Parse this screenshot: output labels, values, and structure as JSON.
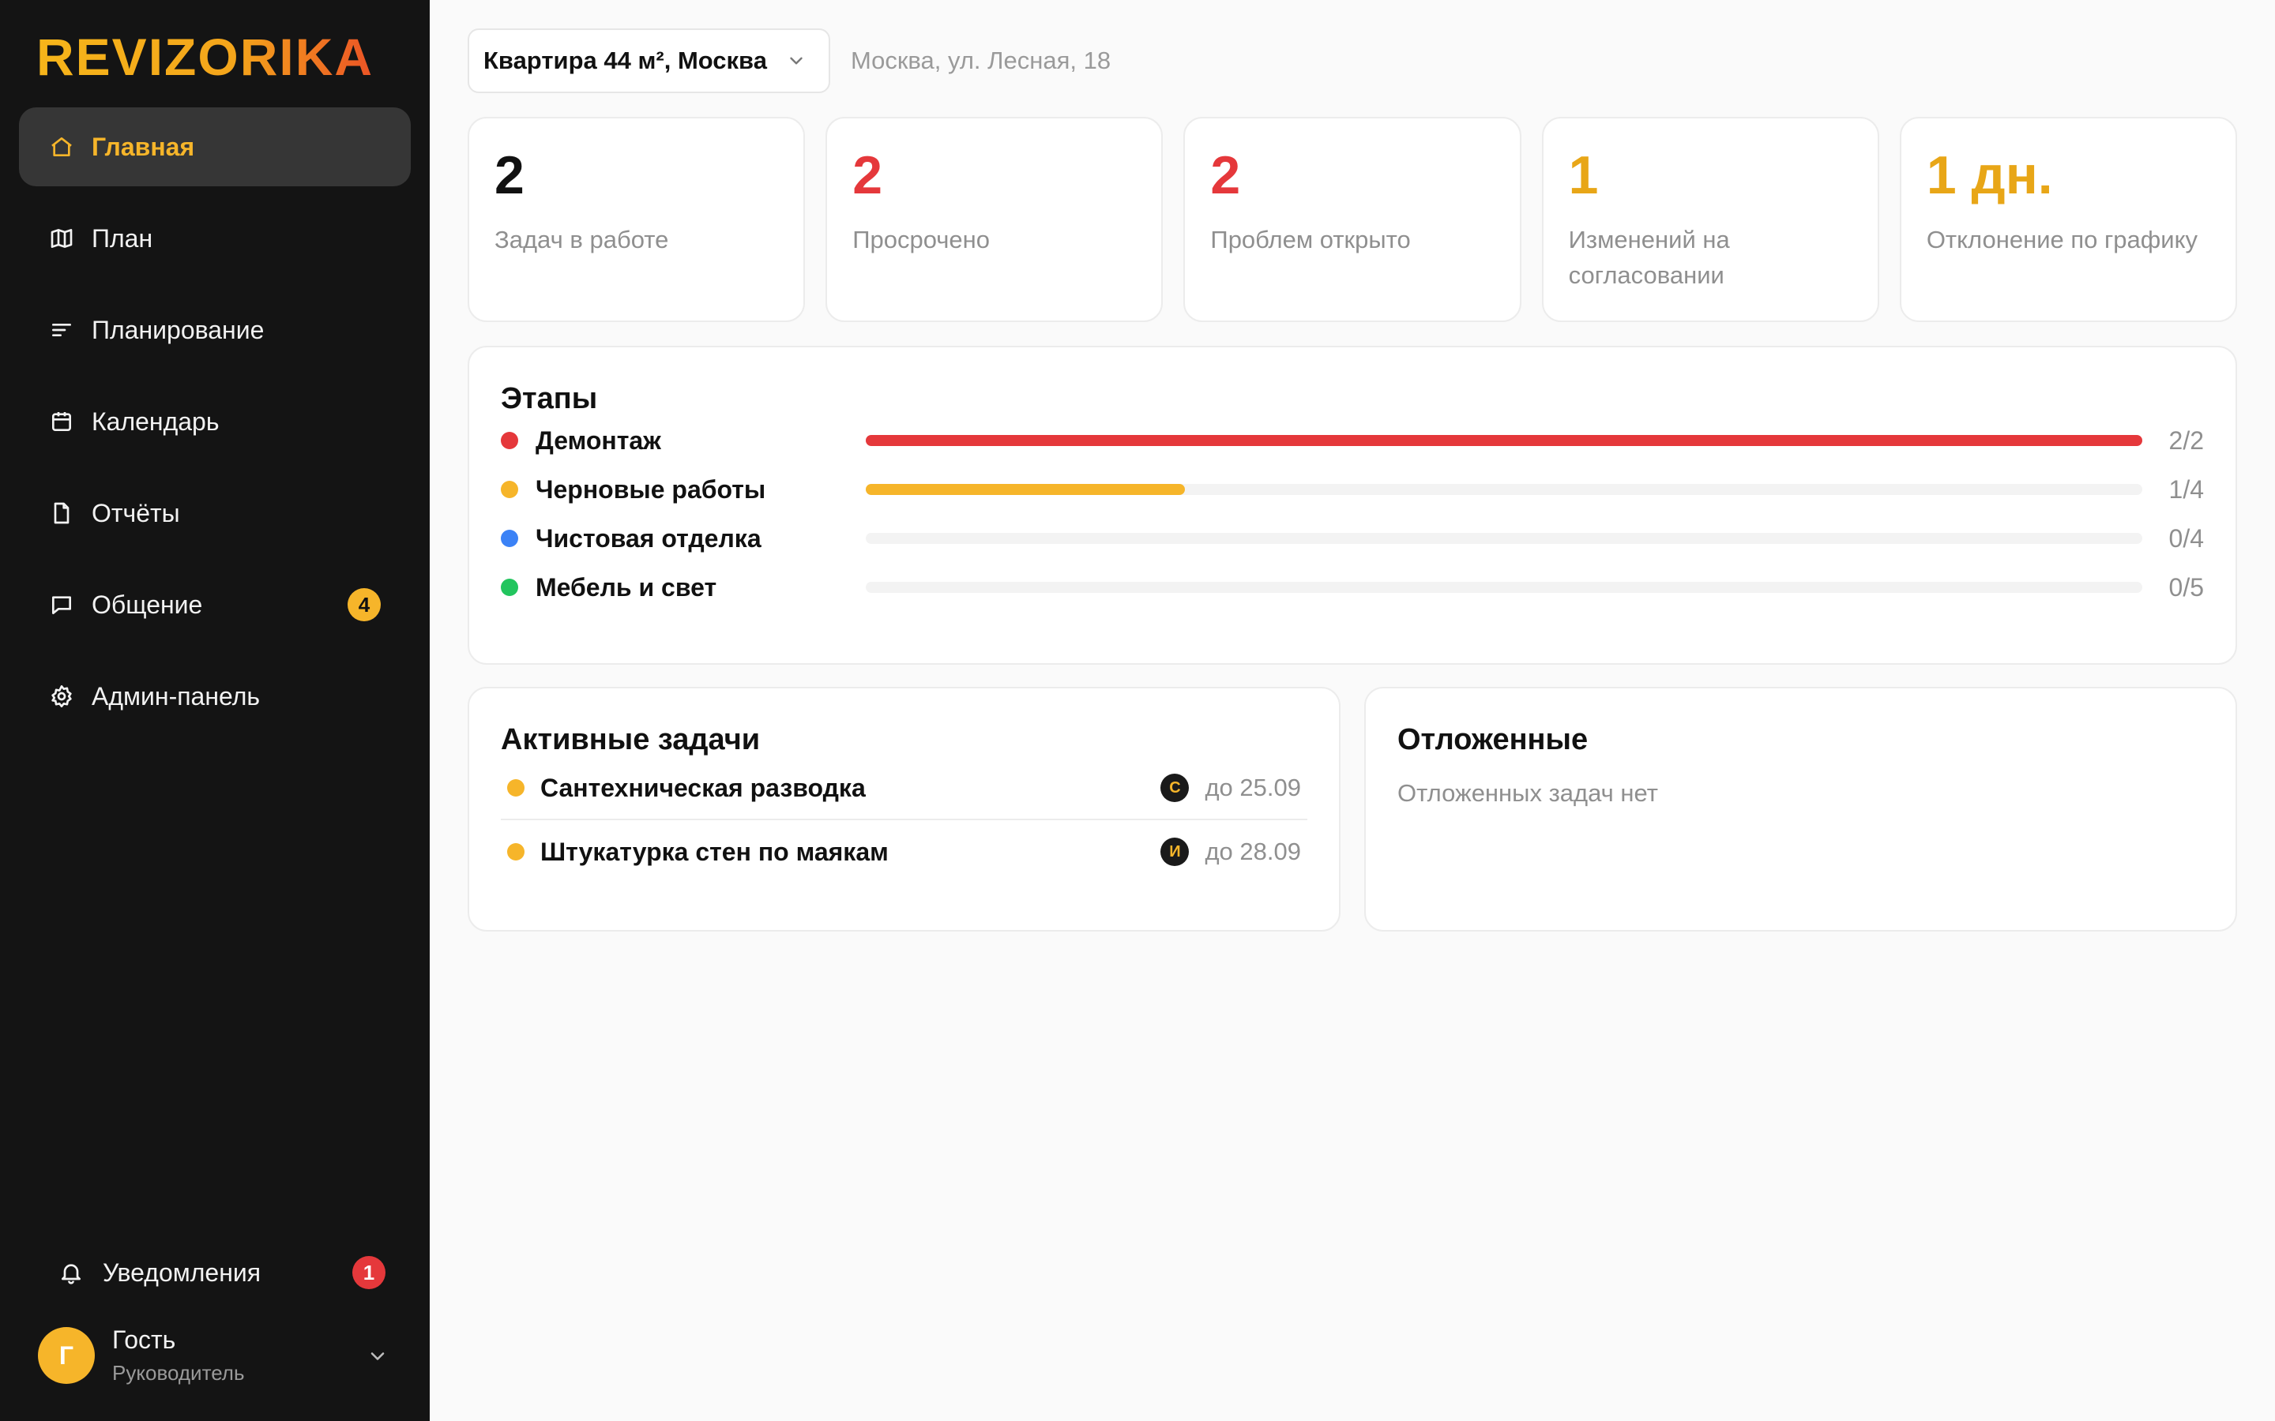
{
  "brand": {
    "logo": "REVIZORIKA"
  },
  "colors": {
    "accent": "#f6b52a",
    "danger": "#e5383b",
    "blue": "#3b82f6",
    "green": "#22c55e"
  },
  "sidebar": {
    "items": [
      {
        "label": "Главная",
        "icon": "home-icon",
        "active": true
      },
      {
        "label": "План",
        "icon": "map-icon"
      },
      {
        "label": "Планирование",
        "icon": "list-icon"
      },
      {
        "label": "Календарь",
        "icon": "calendar-icon"
      },
      {
        "label": "Отчёты",
        "icon": "document-icon"
      },
      {
        "label": "Общение",
        "icon": "chat-icon",
        "badge": "4"
      },
      {
        "label": "Админ-панель",
        "icon": "gear-icon"
      }
    ],
    "notifications": {
      "label": "Уведомления",
      "badge": "1"
    },
    "user": {
      "initial": "Г",
      "name": "Гость",
      "role": "Руководитель"
    }
  },
  "topbar": {
    "object": "Квартира 44 м², Москва",
    "address": "Москва, ул. Лесная, 18"
  },
  "stats": [
    {
      "value": "2",
      "label": "Задач в работе",
      "color": "#111111"
    },
    {
      "value": "2",
      "label": "Просрочено",
      "color": "#e5383b"
    },
    {
      "value": "2",
      "label": "Проблем открыто",
      "color": "#e5383b"
    },
    {
      "value": "1",
      "label": "Изменений на согласовании",
      "color": "#e8a617"
    },
    {
      "value": "1 дн.",
      "label": "Отклонение по графику",
      "color": "#e8a617"
    }
  ],
  "stages": {
    "title": "Этапы",
    "items": [
      {
        "name": "Демонтаж",
        "count": "2/2",
        "done": 2,
        "total": 2,
        "color": "#e5383b"
      },
      {
        "name": "Черновые работы",
        "count": "1/4",
        "done": 1,
        "total": 4,
        "color": "#f6b52a"
      },
      {
        "name": "Чистовая отделка",
        "count": "0/4",
        "done": 0,
        "total": 4,
        "color": "#3b82f6"
      },
      {
        "name": "Мебель и свет",
        "count": "0/5",
        "done": 0,
        "total": 5,
        "color": "#22c55e"
      }
    ]
  },
  "active_tasks": {
    "title": "Активные задачи",
    "items": [
      {
        "name": "Сантехническая разводка",
        "assignee": "С",
        "due": "до 25.09"
      },
      {
        "name": "Штукатурка стен по маякам",
        "assignee": "И",
        "due": "до 28.09"
      }
    ]
  },
  "postponed": {
    "title": "Отложенные",
    "empty": "Отложенных задач нет"
  }
}
